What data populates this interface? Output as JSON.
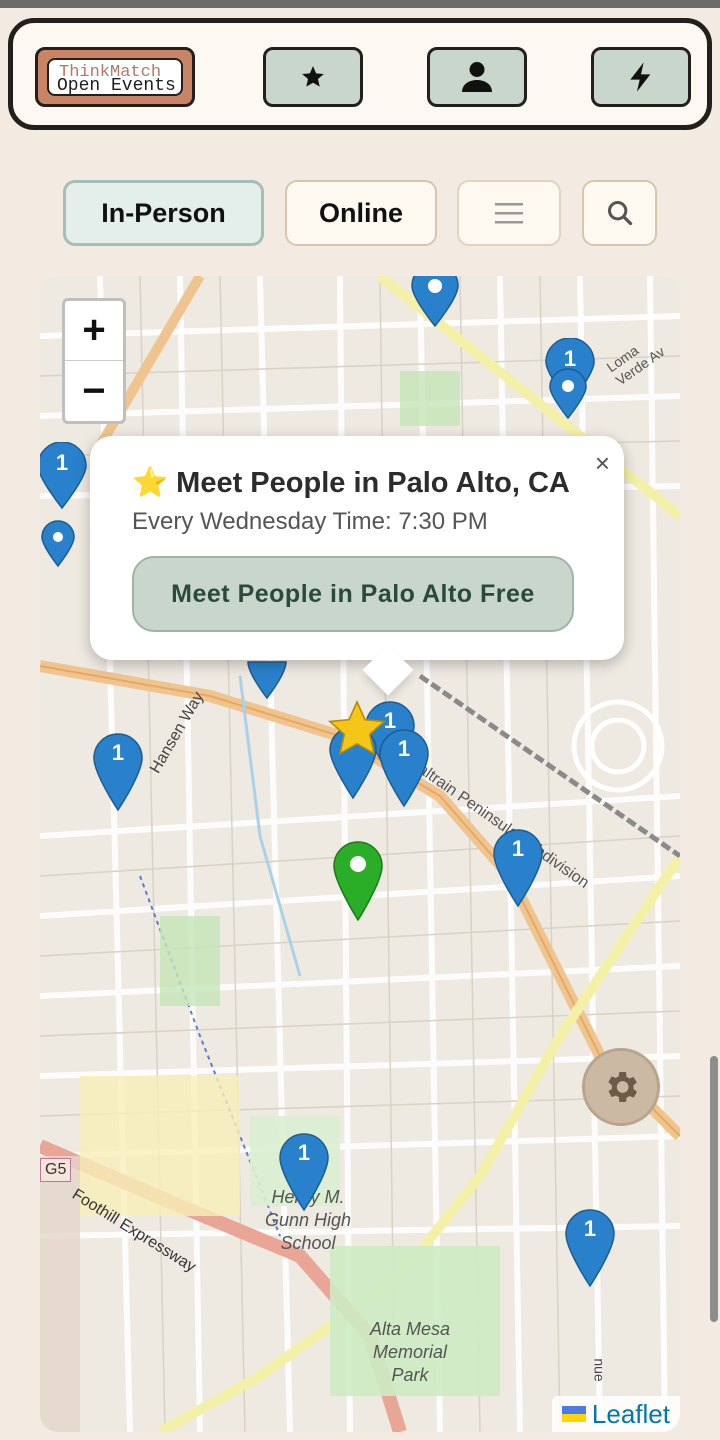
{
  "nav": {
    "logo_line1": "ThinkMatch",
    "logo_line2": "Open Events",
    "star_icon": "star-icon",
    "profile_icon": "person-icon",
    "bolt_icon": "lightning-icon"
  },
  "filters": {
    "in_person": "In-Person",
    "online": "Online",
    "menu_icon": "hamburger-icon",
    "search_icon": "search-icon"
  },
  "map": {
    "zoom_in": "+",
    "zoom_out": "−",
    "labels": {
      "loma_verde": "Loma Verde Av",
      "hansen": "Hansen Way",
      "caltrain": "Caltrain Peninsula Subdivision",
      "g5": "G5",
      "foothill": "Foothill Expressway",
      "gunn": "Henry M. Gunn High School",
      "altamesa": "Alta Mesa Memorial Park",
      "nue": "nue"
    },
    "cluster_count": "1",
    "attribution": "Leaflet"
  },
  "popup": {
    "close": "×",
    "title_icon": "⭐",
    "title": "Meet People in Palo Alto, CA",
    "subtitle": "Every Wednesday Time: 7:30 PM",
    "button": "Meet People in Palo Alto Free"
  },
  "colors": {
    "accent": "#c9d6cb",
    "brand": "#c98466",
    "marker_blue": "#2a81cb",
    "marker_green": "#2aad27",
    "star": "#f5c518"
  }
}
